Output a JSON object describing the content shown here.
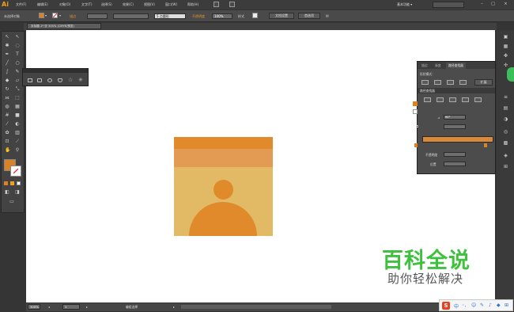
{
  "app": {
    "logo": "Ai",
    "workspace": "基本功能 ▾"
  },
  "menu": [
    "文件(F)",
    "编辑(E)",
    "对象(O)",
    "文字(T)",
    "选择(S)",
    "效果(C)",
    "视图(V)",
    "窗口(W)",
    "帮助(H)"
  ],
  "control": {
    "selection": "未选择对象",
    "stroke_label": "描边",
    "point_style": "5 点圆形",
    "opacity_label": "不透明度",
    "opacity_value": "100%",
    "style_label": "样式",
    "doc_setup": "文档设置",
    "prefs": "首选项"
  },
  "doc_tab": "未标题-1* @ 300% (CMYK/预览)",
  "colors": {
    "fill": "#d98326",
    "accent": "#e8922a",
    "art_light": "#e2ba65",
    "art_orange": "#e08a2c",
    "art_mid": "#e39b53"
  },
  "path_panel": {
    "tabs": [
      "描边",
      "渐变",
      "路径查找器"
    ],
    "shape_modes": "形状模式：",
    "expand": "扩展",
    "pathfinder": "路径查找器",
    "angle": "90°",
    "opacity_label": "不透明度",
    "position_label": "位置"
  },
  "status": {
    "zoom": "300%",
    "page": "1",
    "tool": "编组选择"
  },
  "watermark": {
    "title": "百科全说",
    "subtitle": "助你轻松解决"
  },
  "ime": {
    "logo": "S",
    "lang": "中"
  }
}
